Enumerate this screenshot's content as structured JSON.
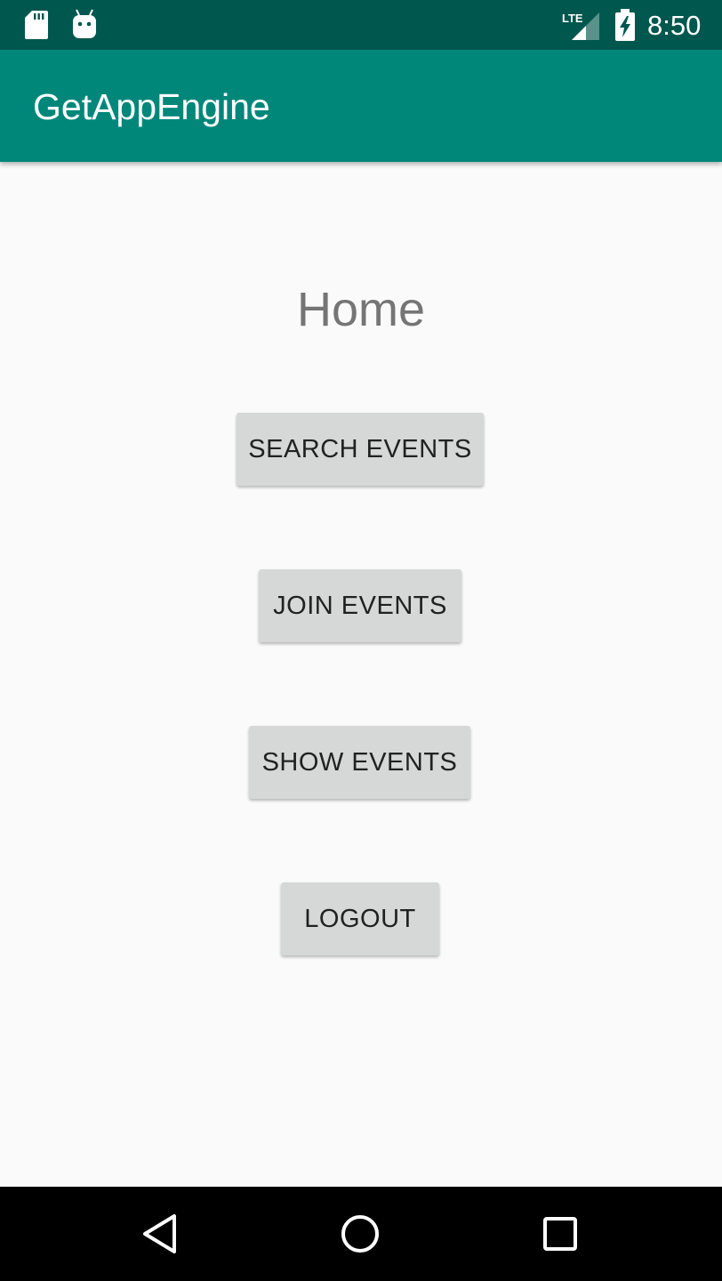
{
  "status_bar": {
    "time": "8:50",
    "network_label": "LTE",
    "icons": [
      "sd-card-icon",
      "android-icon",
      "lte-signal-icon",
      "battery-charging-icon"
    ]
  },
  "app_bar": {
    "title": "GetAppEngine"
  },
  "main": {
    "heading": "Home",
    "buttons": {
      "search_events": "SEARCH EVENTS",
      "join_events": "JOIN EVENTS",
      "show_events": "SHOW EVENTS",
      "logout": "LOGOUT"
    }
  },
  "nav_bar": {
    "icons": [
      "back-icon",
      "home-icon",
      "recents-icon"
    ]
  },
  "colors": {
    "status_bar": "#00574e",
    "app_bar": "#00877a",
    "background": "#fafafa",
    "button": "#d6d7d7",
    "heading_text": "#757575"
  }
}
